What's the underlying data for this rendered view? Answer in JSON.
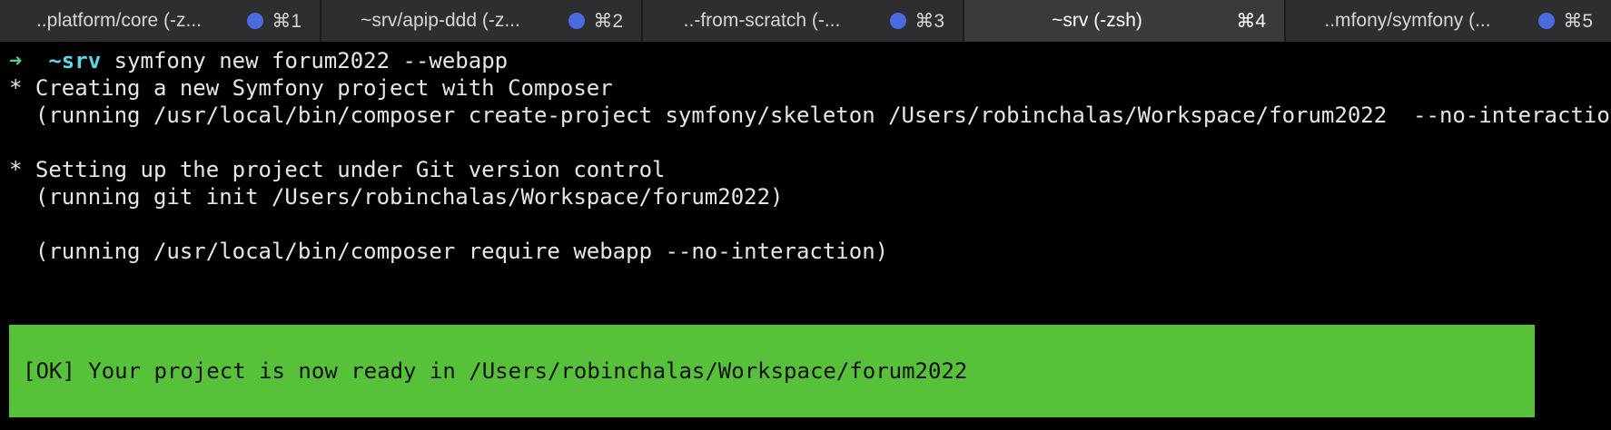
{
  "tabs": [
    {
      "title": "..platform/core (-z...",
      "shortcut": "⌘1",
      "active": false
    },
    {
      "title": "~srv/apip-ddd (-z...",
      "shortcut": "⌘2",
      "active": false
    },
    {
      "title": "..-from-scratch (-...",
      "shortcut": "⌘3",
      "active": false
    },
    {
      "title": "~srv (-zsh)",
      "shortcut": "⌘4",
      "active": true
    },
    {
      "title": "..mfony/symfony (...",
      "shortcut": "⌘5",
      "active": false
    }
  ],
  "terminal": {
    "prompt_arrow": "➜",
    "prompt_dir": "~srv",
    "command": "symfony new forum2022 --webapp",
    "lines": [
      "* Creating a new Symfony project with Composer",
      "  (running /usr/local/bin/composer create-project symfony/skeleton /Users/robinchalas/Workspace/forum2022  --no-interaction)",
      "* Setting up the project under Git version control",
      "  (running git init /Users/robinchalas/Workspace/forum2022)",
      "  (running /usr/local/bin/composer require webapp --no-interaction)"
    ],
    "ok_message": "[OK] Your project is now ready in /Users/robinchalas/Workspace/forum2022"
  },
  "colors": {
    "background": "#000000",
    "prompt_arrow": "#4fd38a",
    "prompt_dir": "#5ad7e8",
    "ok_block": "#58c13a",
    "tab_dot": "#4a6be0"
  }
}
